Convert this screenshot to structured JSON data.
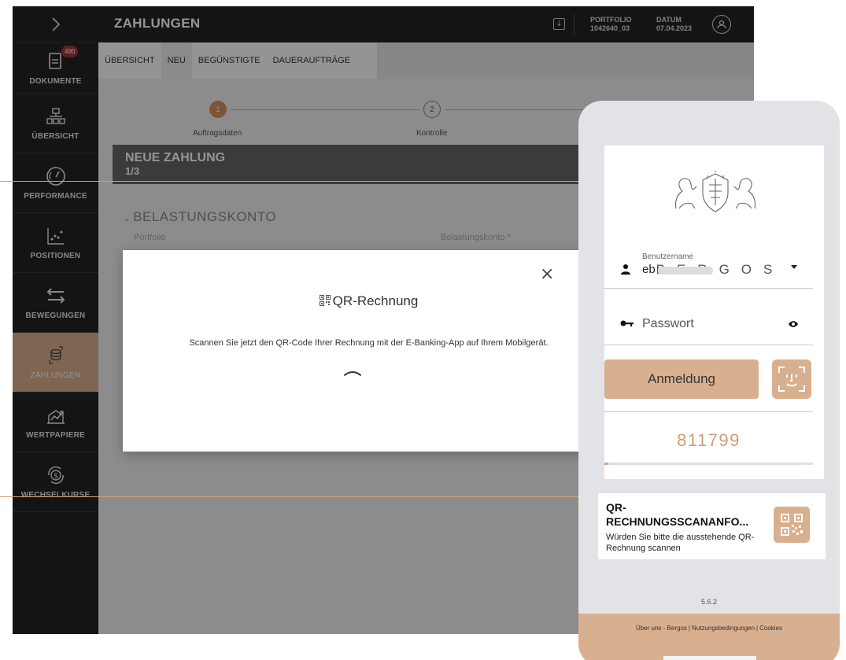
{
  "topbar": {
    "title": "ZAHLUNGEN",
    "portfolio_label": "PORTFOLIO",
    "portfolio_value": "1042640_03",
    "date_label": "DATUM",
    "date_value": "07.04.2023"
  },
  "sidebar": {
    "items": [
      {
        "label": "DOKUMENTE",
        "badge": "490",
        "icon": "document-icon"
      },
      {
        "label": "ÜBERSICHT",
        "icon": "hierarchy-icon"
      },
      {
        "label": "PERFORMANCE",
        "icon": "gauge-icon"
      },
      {
        "label": "POSITIONEN",
        "icon": "scatter-chart-icon"
      },
      {
        "label": "BEWEGUNGEN",
        "icon": "arrows-icon"
      },
      {
        "label": "ZAHLUNGEN",
        "icon": "coins-icon"
      },
      {
        "label": "WERTPAPIERE",
        "icon": "securities-icon"
      },
      {
        "label": "WECHSELKURSE",
        "icon": "currency-exchange-icon"
      }
    ]
  },
  "tabs": [
    "ÜBERSICHT",
    "NEU",
    "BEGÜNSTIGTE",
    "DAUERAUFTRÄGE"
  ],
  "stepper": {
    "steps": [
      {
        "number": "1",
        "label": "Auftragsdaten"
      },
      {
        "number": "2",
        "label": "Kontrolle"
      }
    ]
  },
  "form": {
    "title": "NEUE ZAHLUNG",
    "step": "1/3",
    "section": "BELASTUNGSKONTO",
    "field_portfolio": "Portfolio",
    "field_account": "Belastungskonto *"
  },
  "dialog": {
    "title": "QR-Rechnung",
    "text": "Scannen Sie jetzt den QR-Code Ihrer Rechnung mit der E-Banking-App auf Ihrem Mobilgerät."
  },
  "phone": {
    "brand": "BERGOS",
    "username_label": "Benutzername",
    "username_value": "eb",
    "password_placeholder": "Passwort",
    "login_label": "Anmeldung",
    "otp_code": "811799",
    "otp_progress": 0.02,
    "notice_title": "QR-RECHNUNGSSCANANFO...",
    "notice_text": "Würden Sie bitte die ausstehende QR-Rechnung scannen",
    "version": "5.6.2",
    "footer_links": [
      "Über uns - Bergos",
      "Nutzungsbedingungen",
      "Cookies"
    ]
  },
  "colors": {
    "accent": "#d9b08f",
    "accent_text": "#d29b75",
    "dark": "#242424",
    "badge": "#a63a34"
  }
}
